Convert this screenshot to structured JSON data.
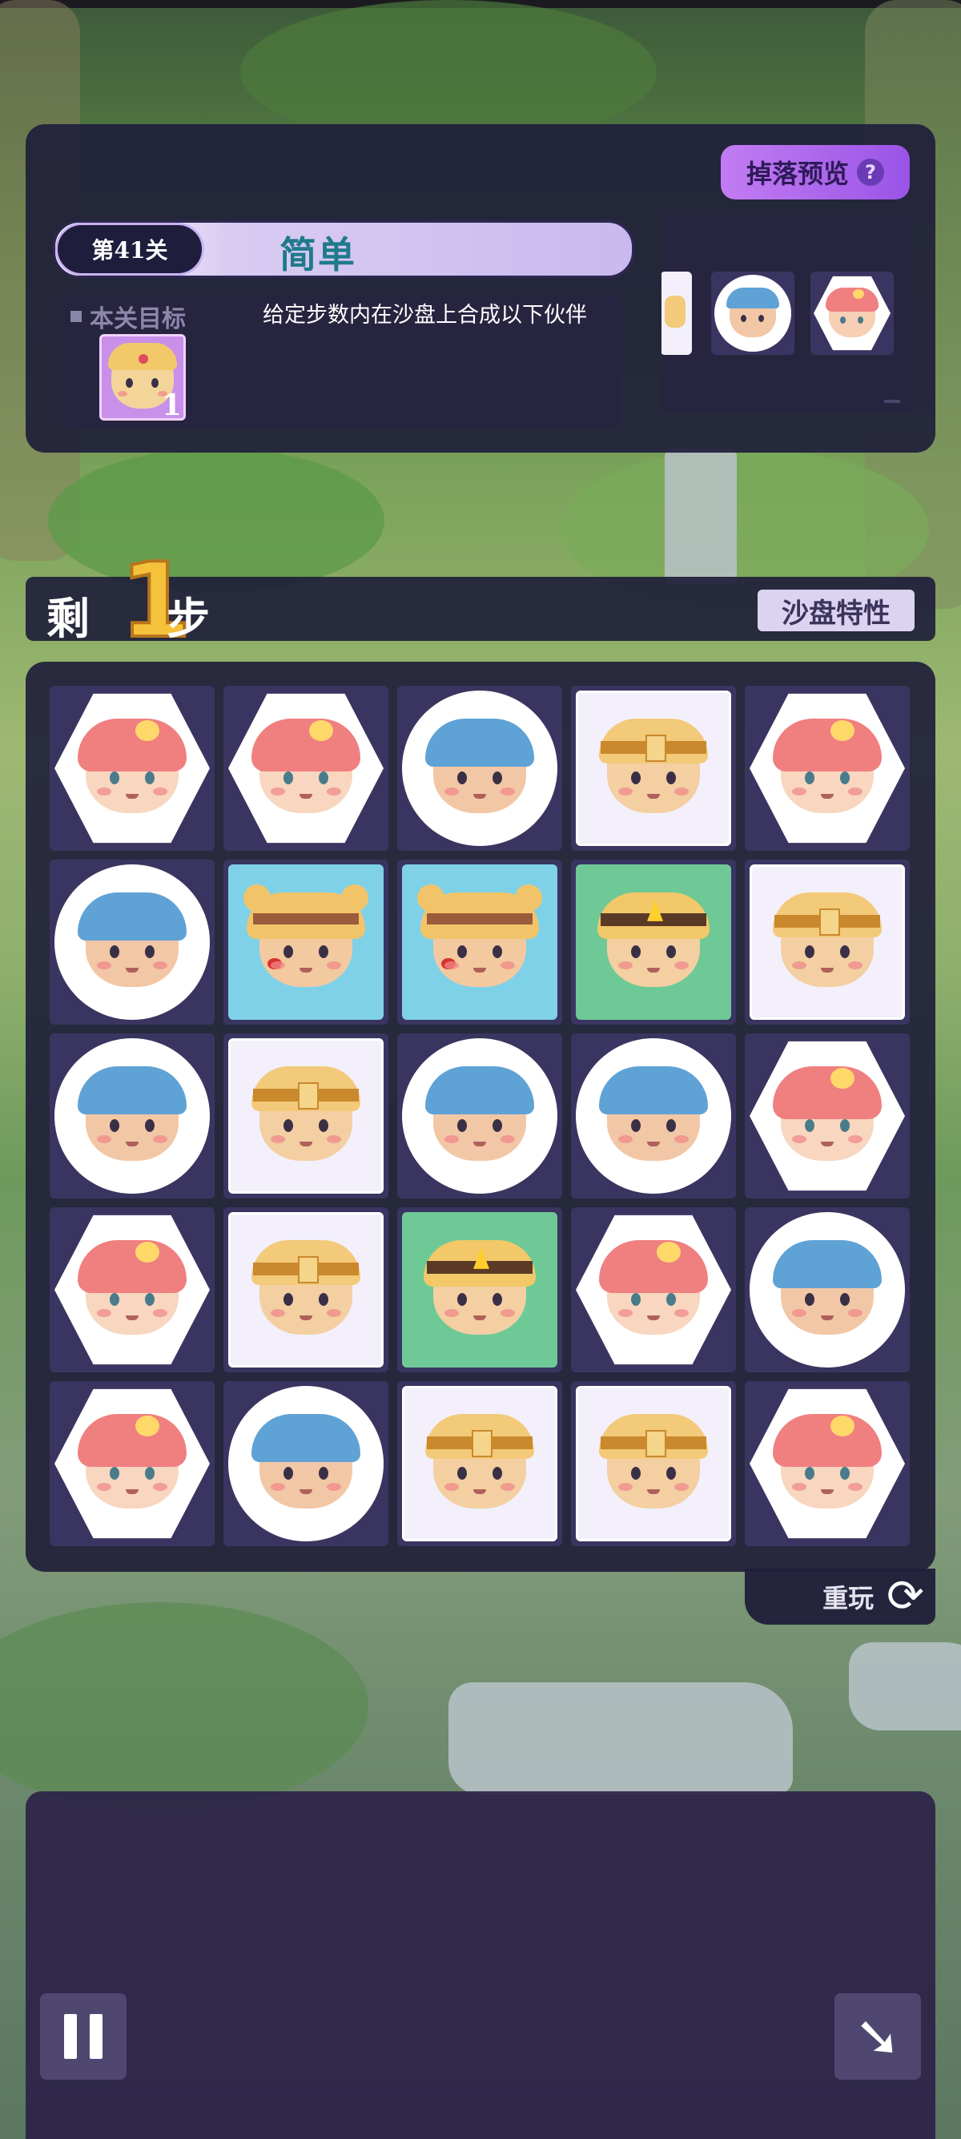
{
  "drop_preview_label": "掉落预览",
  "help_icon": "?",
  "level": "第41关",
  "difficulty": "简单",
  "goal": {
    "label": "本关目标",
    "description": "给定步数内在沙盘上合成以下伙伴",
    "item_count": "1",
    "item_character": "gold-helmet-hero"
  },
  "preview_items": [
    "gold-headband-kid",
    "blue-helmet-kid",
    "pink-chick-girl"
  ],
  "steps": {
    "prefix": "剩",
    "count": "1",
    "suffix": "步"
  },
  "sandbox_feature_label": "沙盘特性",
  "board": [
    [
      "pink-chick-girl",
      "pink-chick-girl",
      "blue-helmet-kid",
      "gold-headband-kid",
      "pink-chick-girl"
    ],
    [
      "blue-helmet-kid",
      "bear-ears-kid",
      "bear-ears-kid",
      "gold-crown-kid",
      "gold-headband-kid"
    ],
    [
      "blue-helmet-kid",
      "gold-headband-kid",
      "blue-helmet-kid",
      "blue-helmet-kid",
      "pink-chick-girl"
    ],
    [
      "pink-chick-girl",
      "gold-headband-kid",
      "gold-crown-kid",
      "pink-chick-girl",
      "blue-helmet-kid"
    ],
    [
      "pink-chick-girl",
      "blue-helmet-kid",
      "gold-headband-kid",
      "gold-headband-kid",
      "pink-chick-girl"
    ]
  ],
  "replay_label": "重玩",
  "colors": {
    "panel": "#201e3a",
    "accent": "#9a54e6",
    "step_number": "#f5c23c"
  },
  "icons": {
    "pause": "pause-icon",
    "skip": "skip-arrow-icon",
    "replay": "refresh-icon"
  }
}
